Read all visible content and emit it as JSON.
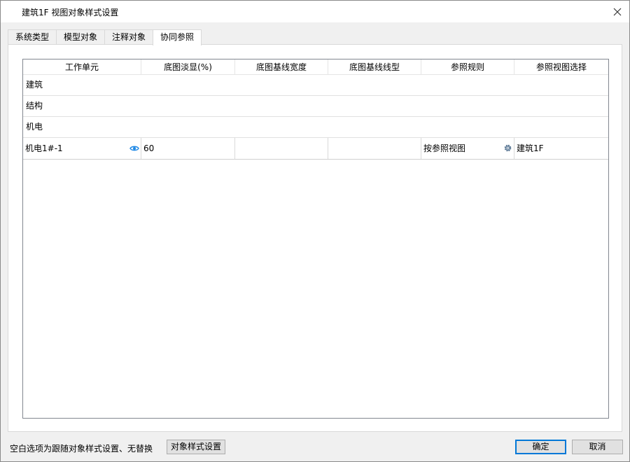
{
  "window": {
    "title": "建筑1F 视图对象样式设置"
  },
  "tabs": [
    {
      "label": "系统类型"
    },
    {
      "label": "模型对象"
    },
    {
      "label": "注释对象"
    },
    {
      "label": "协同参照",
      "active": true
    }
  ],
  "grid": {
    "columns": [
      "工作单元",
      "底图淡显(%)",
      "底图基线宽度",
      "底图基线线型",
      "参照规则",
      "参照视图选择"
    ],
    "groups": [
      "建筑",
      "结构",
      "机电"
    ],
    "row": {
      "work_unit": "机电1#-1",
      "fade": "60",
      "line_width": "",
      "line_type": "",
      "rule": "按参照视图",
      "view": "建筑1F"
    }
  },
  "footer": {
    "hint": "空白选项为跟随对象样式设置、无替换",
    "object_style_button": "对象样式设置",
    "ok_button": "确定",
    "cancel_button": "取消"
  },
  "colors": {
    "eye_icon": "#1e88e5",
    "gear_icon": "#4a6a8a",
    "selected_border": "#0078d7"
  }
}
